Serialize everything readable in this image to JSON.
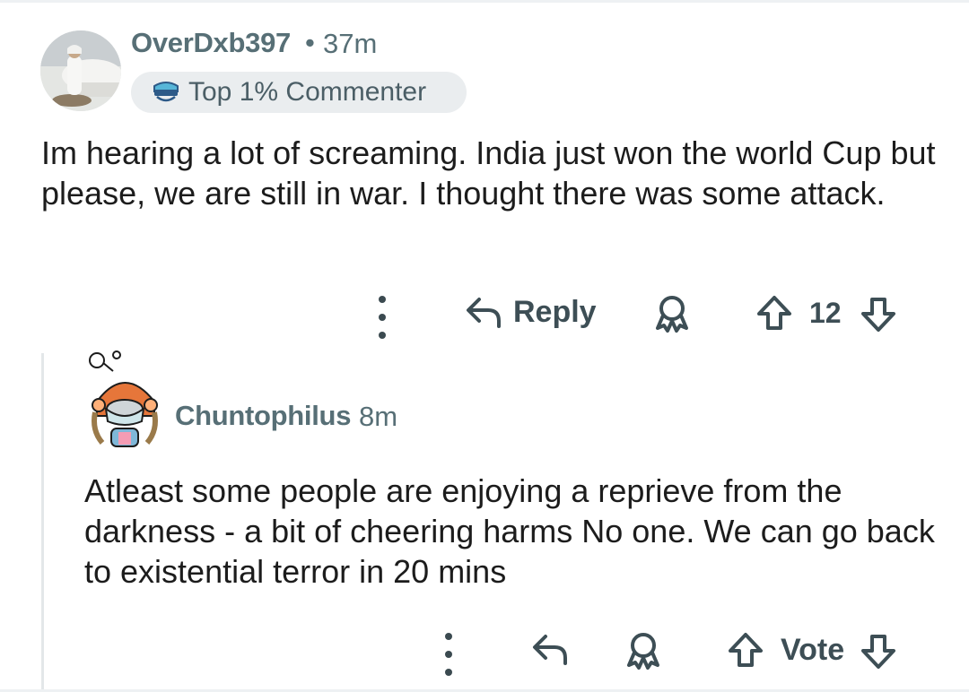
{
  "parent_comment": {
    "username": "OverDxb397",
    "separator": "•",
    "time": "37m",
    "flair": {
      "icon": "sunglasses-icon",
      "text": "Top 1% Commenter"
    },
    "body": "Im hearing a lot of screaming. India just won the world Cup but please, we are still in war. I thought there was some attack.",
    "actions": {
      "reply_label": "Reply",
      "vote_count": "12"
    }
  },
  "reply_comment": {
    "username": "Chuntophilus",
    "time": "8m",
    "body": "Atleast some people are enjoying a reprieve from the darkness - a bit of cheering harms No one. We can go back to existential terror in 20 mins",
    "actions": {
      "vote_label": "Vote"
    }
  },
  "colors": {
    "meta_text": "#576f76",
    "body_text": "#1c1c1c",
    "action_icon": "#3d4e55",
    "flair_bg": "#eaedef",
    "thread_line": "#e3e7e9"
  }
}
